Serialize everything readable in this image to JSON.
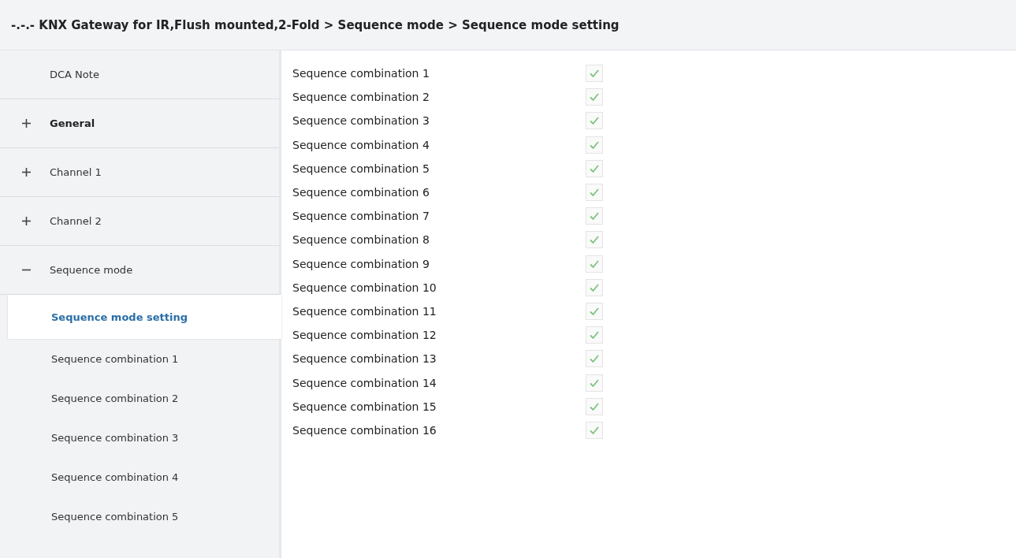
{
  "window": {
    "title": "-.-.- KNX Gateway for IR,Flush mounted,2-Fold > Sequence mode > Sequence mode setting"
  },
  "sidebar": {
    "items": [
      {
        "label": "DCA Note",
        "kind": "leaf",
        "bold": false,
        "selected": false
      },
      {
        "label": "General",
        "kind": "group",
        "expanded": false,
        "bold": true,
        "selected": false
      },
      {
        "label": "Channel 1",
        "kind": "group",
        "expanded": false,
        "bold": false,
        "selected": false
      },
      {
        "label": "Channel 2",
        "kind": "group",
        "expanded": false,
        "bold": false,
        "selected": false
      },
      {
        "label": "Sequence mode",
        "kind": "group",
        "expanded": true,
        "bold": false,
        "selected": false,
        "children": [
          {
            "label": "Sequence mode setting",
            "selected": true
          },
          {
            "label": "Sequence combination 1",
            "selected": false
          },
          {
            "label": "Sequence combination 2",
            "selected": false
          },
          {
            "label": "Sequence combination 3",
            "selected": false
          },
          {
            "label": "Sequence combination 4",
            "selected": false
          },
          {
            "label": "Sequence combination 5",
            "selected": false
          }
        ]
      }
    ]
  },
  "settings": [
    {
      "label": "Sequence combination 1",
      "checked": true
    },
    {
      "label": "Sequence combination 2",
      "checked": true
    },
    {
      "label": "Sequence combination 3",
      "checked": true
    },
    {
      "label": "Sequence combination 4",
      "checked": true
    },
    {
      "label": "Sequence combination 5",
      "checked": true
    },
    {
      "label": "Sequence combination 6",
      "checked": true
    },
    {
      "label": "Sequence combination 7",
      "checked": true
    },
    {
      "label": "Sequence combination 8",
      "checked": true
    },
    {
      "label": "Sequence combination 9",
      "checked": true
    },
    {
      "label": "Sequence combination 10",
      "checked": true
    },
    {
      "label": "Sequence combination 11",
      "checked": true
    },
    {
      "label": "Sequence combination 12",
      "checked": true
    },
    {
      "label": "Sequence combination 13",
      "checked": true
    },
    {
      "label": "Sequence combination 14",
      "checked": true
    },
    {
      "label": "Sequence combination 15",
      "checked": true
    },
    {
      "label": "Sequence combination 16",
      "checked": true
    }
  ]
}
